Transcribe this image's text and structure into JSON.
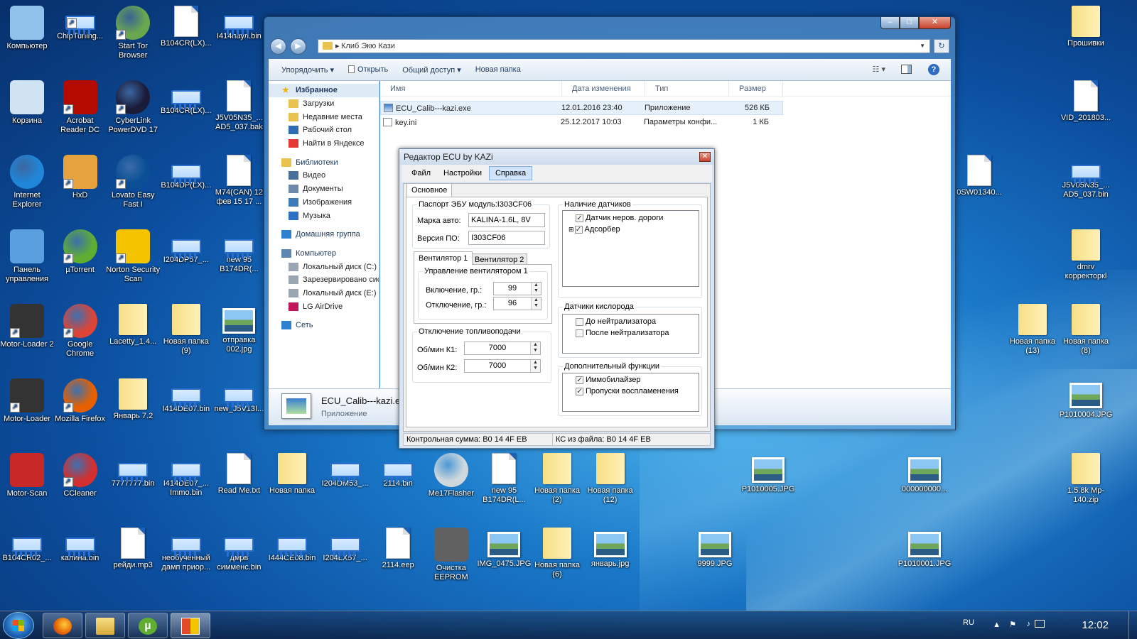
{
  "desktop": {
    "icons": [
      {
        "label": "Компьютер",
        "type": "app",
        "color": "#8fc1ea",
        "shortcut": false,
        "col": 0,
        "row": 0
      },
      {
        "label": "ChipTuning...",
        "type": "chip",
        "shortcut": true,
        "col": 1,
        "row": 0
      },
      {
        "label": "Start Tor Browser",
        "type": "round",
        "color": "#6aa84f",
        "shortcut": true,
        "col": 2,
        "row": 0
      },
      {
        "label": "B104CR(LX)...",
        "type": "doc",
        "shortcut": false,
        "col": 3,
        "row": 0
      },
      {
        "label": "I414паул.bin",
        "type": "chip",
        "shortcut": false,
        "col": 4,
        "row": 0
      },
      {
        "label": "Корзина",
        "type": "app",
        "color": "#cfe3f3",
        "shortcut": false,
        "col": 0,
        "row": 1
      },
      {
        "label": "Acrobat Reader DC",
        "type": "app",
        "color": "#b30b00",
        "shortcut": true,
        "col": 1,
        "row": 1
      },
      {
        "label": "CyberLink PowerDVD 17",
        "type": "round",
        "color": "#1b1b3a",
        "shortcut": true,
        "col": 2,
        "row": 1
      },
      {
        "label": "B104CR(LX)...",
        "type": "chip",
        "shortcut": false,
        "col": 3,
        "row": 1
      },
      {
        "label": "J5V05N35_... AD5_037.bak",
        "type": "doc",
        "shortcut": false,
        "col": 4,
        "row": 1
      },
      {
        "label": "Internet Explorer",
        "type": "round",
        "color": "#1f86d9",
        "shortcut": false,
        "col": 0,
        "row": 2
      },
      {
        "label": "HxD",
        "type": "app",
        "color": "#e6a23c",
        "shortcut": true,
        "col": 1,
        "row": 2
      },
      {
        "label": "Lovato Easy Fast I",
        "type": "round",
        "color": "#0a4f95",
        "shortcut": true,
        "col": 2,
        "row": 2
      },
      {
        "label": "B104DP(LX)...",
        "type": "chip",
        "shortcut": false,
        "col": 3,
        "row": 2
      },
      {
        "label": "M74(CAN) 12 фев 15 17 ...",
        "type": "doc",
        "shortcut": false,
        "col": 4,
        "row": 2
      },
      {
        "label": "Панель управления",
        "type": "app",
        "color": "#5aa0de",
        "shortcut": false,
        "col": 0,
        "row": 3
      },
      {
        "label": "µTorrent",
        "type": "round",
        "color": "#5fae32",
        "shortcut": true,
        "col": 1,
        "row": 3
      },
      {
        "label": "Norton Security Scan",
        "type": "app",
        "color": "#f5c400",
        "shortcut": true,
        "col": 2,
        "row": 3
      },
      {
        "label": "I204DP57_...",
        "type": "chip",
        "shortcut": false,
        "col": 3,
        "row": 3
      },
      {
        "label": "new 95 B174DR(...",
        "type": "chip",
        "shortcut": false,
        "col": 4,
        "row": 3
      },
      {
        "label": "Motor-Loader 2",
        "type": "app",
        "color": "#333333",
        "shortcut": true,
        "col": 0,
        "row": 4
      },
      {
        "label": "Google Chrome",
        "type": "round",
        "color": "#db4437",
        "shortcut": true,
        "col": 1,
        "row": 4
      },
      {
        "label": "Lacetty_1.4...",
        "type": "folder",
        "shortcut": false,
        "col": 2,
        "row": 4
      },
      {
        "label": "Новая папка (9)",
        "type": "folder",
        "shortcut": false,
        "col": 3,
        "row": 4
      },
      {
        "label": "отправка 002.jpg",
        "type": "pic",
        "shortcut": false,
        "col": 4,
        "row": 4
      },
      {
        "label": "Motor-Loader",
        "type": "app",
        "color": "#333333",
        "shortcut": true,
        "col": 0,
        "row": 5
      },
      {
        "label": "Mozilla Firefox",
        "type": "round",
        "color": "#e66000",
        "shortcut": true,
        "col": 1,
        "row": 5
      },
      {
        "label": "Январь 7.2",
        "type": "folder",
        "shortcut": false,
        "col": 2,
        "row": 5
      },
      {
        "label": "I414DE07.bin",
        "type": "chip",
        "shortcut": false,
        "col": 3,
        "row": 5
      },
      {
        "label": "new_J5V13I...",
        "type": "chip",
        "shortcut": false,
        "col": 4,
        "row": 5
      },
      {
        "label": "Motor-Scan",
        "type": "app",
        "color": "#c62828",
        "shortcut": false,
        "col": 0,
        "row": 6
      },
      {
        "label": "CCleaner",
        "type": "round",
        "color": "#d32f2f",
        "shortcut": true,
        "col": 1,
        "row": 6
      },
      {
        "label": "7777777.bin",
        "type": "chip",
        "shortcut": false,
        "col": 2,
        "row": 6
      },
      {
        "label": "I414DE07_... Immo.bin",
        "type": "chip",
        "shortcut": false,
        "col": 3,
        "row": 6
      },
      {
        "label": "Read Me.txt",
        "type": "doc",
        "shortcut": false,
        "col": 4,
        "row": 6
      },
      {
        "label": "Новая папка",
        "type": "folder",
        "shortcut": false,
        "col": 5,
        "row": 6
      },
      {
        "label": "I204DM53_...",
        "type": "chip",
        "shortcut": false,
        "col": 6,
        "row": 6
      },
      {
        "label": "2114.bin",
        "type": "chip",
        "shortcut": false,
        "col": 7,
        "row": 6
      },
      {
        "label": "Me17Flasher",
        "type": "round",
        "color": "#cfd8dc",
        "shortcut": false,
        "col": 8,
        "row": 6
      },
      {
        "label": "new 95 B174DR(L...",
        "type": "doc",
        "shortcut": false,
        "col": 9,
        "row": 6
      },
      {
        "label": "Новая папка (2)",
        "type": "folder",
        "shortcut": false,
        "col": 10,
        "row": 6
      },
      {
        "label": "Новая папка (12)",
        "type": "folder",
        "shortcut": false,
        "col": 11,
        "row": 6
      },
      {
        "label": "B104CR02_...",
        "type": "chip",
        "shortcut": false,
        "col": 0,
        "row": 7
      },
      {
        "label": "калина.bin",
        "type": "chip",
        "shortcut": false,
        "col": 1,
        "row": 7
      },
      {
        "label": "рейди.mp3",
        "type": "doc",
        "shortcut": false,
        "col": 2,
        "row": 7
      },
      {
        "label": "необученный дамп приор...",
        "type": "chip",
        "shortcut": false,
        "col": 3,
        "row": 7
      },
      {
        "label": "дмрв симменс.bin",
        "type": "chip",
        "shortcut": false,
        "col": 4,
        "row": 7
      },
      {
        "label": "I444CE08.bin",
        "type": "chip",
        "shortcut": false,
        "col": 5,
        "row": 7
      },
      {
        "label": "I204LX57_...",
        "type": "chip",
        "shortcut": false,
        "col": 6,
        "row": 7
      },
      {
        "label": "2114.eep",
        "type": "doc",
        "shortcut": false,
        "col": 7,
        "row": 7
      },
      {
        "label": "Очистка EEPROM",
        "type": "app",
        "color": "#616161",
        "shortcut": false,
        "col": 8,
        "row": 7
      },
      {
        "label": "IMG_0475.JPG",
        "type": "pic",
        "shortcut": false,
        "col": 9,
        "row": 7
      },
      {
        "label": "Новая папка (6)",
        "type": "folder",
        "shortcut": false,
        "col": 10,
        "row": 7
      },
      {
        "label": "январь.jpg",
        "type": "pic",
        "shortcut": false,
        "col": 11,
        "row": 7
      },
      {
        "label": "9999.JPG",
        "type": "pic",
        "shortcut": false,
        "col": 13,
        "row": 7
      },
      {
        "label": "P1010001.JPG",
        "type": "pic",
        "shortcut": false,
        "col": 17,
        "row": 7
      },
      {
        "label": "P1010005.JPG",
        "type": "pic",
        "shortcut": false,
        "col": 14,
        "row": 6
      },
      {
        "label": "000000000...",
        "type": "pic",
        "shortcut": false,
        "col": 17,
        "row": 6
      },
      {
        "label": "0SW01340...",
        "type": "doc",
        "shortcut": false,
        "col": 18,
        "row": 2
      },
      {
        "label": "Прошивки",
        "type": "folder",
        "shortcut": false,
        "col": 20,
        "row": 0
      },
      {
        "label": "VID_201803...",
        "type": "doc",
        "shortcut": false,
        "col": 20,
        "row": 1
      },
      {
        "label": "J5V05N35_... AD5_037.bin",
        "type": "chip",
        "shortcut": false,
        "col": 20,
        "row": 2
      },
      {
        "label": "dmrv корректоркl",
        "type": "folder",
        "shortcut": false,
        "col": 20,
        "row": 3
      },
      {
        "label": "Новая папка (13)",
        "type": "folder",
        "shortcut": false,
        "col": 19,
        "row": 4
      },
      {
        "label": "Новая папка (8)",
        "type": "folder",
        "shortcut": false,
        "col": 20,
        "row": 4
      },
      {
        "label": "P1010004.JPG",
        "type": "pic",
        "shortcut": false,
        "col": 20,
        "row": 5
      },
      {
        "label": "1.5.8k Mp-140.zip",
        "type": "folder",
        "shortcut": false,
        "col": 20,
        "row": 6
      }
    ]
  },
  "explorer": {
    "address": "Клиб Экю Кази",
    "toolbar": [
      "Упорядочить ▾",
      "Открыть",
      "Общий доступ ▾",
      "Новая папка"
    ],
    "nav": [
      {
        "label": "Избранное",
        "head": true,
        "sel": true,
        "icon": "star-icon",
        "color": "#f0b300"
      },
      {
        "label": "Загрузки",
        "icon": "folder-icon",
        "color": "#e8c350"
      },
      {
        "label": "Недавние места",
        "icon": "folder-icon",
        "color": "#e8c350"
      },
      {
        "label": "Рабочий стол",
        "icon": "desktop-icon",
        "color": "#2e6db4"
      },
      {
        "label": "Найти в Яндексе",
        "icon": "yandex-icon",
        "color": "#e53935"
      },
      {
        "label": "Библиотеки",
        "head": true,
        "icon": "library-icon",
        "color": "#e8c350"
      },
      {
        "label": "Видео",
        "icon": "video-icon",
        "color": "#4a6f9b"
      },
      {
        "label": "Документы",
        "icon": "documents-icon",
        "color": "#6d88a8"
      },
      {
        "label": "Изображения",
        "icon": "pictures-icon",
        "color": "#3d7ab8"
      },
      {
        "label": "Музыка",
        "icon": "music-icon",
        "color": "#2a73c2"
      },
      {
        "label": "Домашняя группа",
        "head": true,
        "icon": "homegroup-icon",
        "color": "#2f80d0"
      },
      {
        "label": "Компьютер",
        "head": true,
        "icon": "computer-icon",
        "color": "#5c87b2"
      },
      {
        "label": "Локальный диск (C:)",
        "icon": "drive-icon",
        "color": "#9aa7b3"
      },
      {
        "label": "Зарезервировано системой",
        "icon": "drive-icon",
        "color": "#9aa7b3"
      },
      {
        "label": "Локальный диск (E:)",
        "icon": "drive-icon",
        "color": "#9aa7b3"
      },
      {
        "label": "LG AirDrive",
        "icon": "airdrive-icon",
        "color": "#c2185b"
      },
      {
        "label": "Сеть",
        "head": true,
        "icon": "network-icon",
        "color": "#2f80d0"
      }
    ],
    "columns": [
      "Имя",
      "Дата изменения",
      "Тип",
      "Размер"
    ],
    "files": [
      {
        "name": "ECU_Calib---kazi.exe",
        "date": "12.01.2016 23:40",
        "type": "Приложение",
        "size": "526 КБ"
      },
      {
        "name": "key.ini",
        "date": "25.12.2017 10:03",
        "type": "Параметры конфи...",
        "size": "1 КБ"
      }
    ],
    "details": {
      "name": "ECU_Calib---kazi.exe",
      "type": "Приложение"
    }
  },
  "ecu": {
    "title": "Редактор ECU by  KAZi",
    "menu": [
      "Файл",
      "Настройки",
      "Справка"
    ],
    "tab": "Основное",
    "passport": {
      "title": "Паспорт ЭБУ модуль:I303CF06",
      "car_label": "Марка авто:",
      "car_value": "KALINA-1.6L, 8V",
      "ver_label": "Версия ПО:",
      "ver_value": "I303CF06"
    },
    "fan_tabs": [
      "Вентилятор 1",
      "Вентилятор 2"
    ],
    "fan": {
      "title": "Управление вентилятором 1",
      "on_label": "Включение, гр.:",
      "on_value": "99",
      "off_label": "Отключение, гр.:",
      "off_value": "96"
    },
    "fuel": {
      "title": "Отключение топливоподачи",
      "k1_label": "Об/мин К1:",
      "k1_value": "7000",
      "k2_label": "Об/мин К2:",
      "k2_value": "7000"
    },
    "sensors": {
      "title": "Наличие датчиков",
      "items": [
        {
          "label": "Датчик неров. дороги",
          "checked": true
        },
        {
          "label": "Адсорбер",
          "checked": true
        }
      ]
    },
    "oxygen": {
      "title": "Датчики кислорода",
      "items": [
        {
          "label": "До нейтрализатора",
          "checked": false
        },
        {
          "label": "После нейтрализатора",
          "checked": false
        }
      ]
    },
    "extra": {
      "title": "Дополнительный функции",
      "items": [
        {
          "label": "Иммобилайзер",
          "checked": true
        },
        {
          "label": "Пропуски воспламенения",
          "checked": true
        }
      ]
    },
    "status": {
      "checksum": "Контрольная сумма: B0 14 4F EB",
      "file_checksum": "КС из файла: B0 14 4F EB"
    }
  },
  "taskbar": {
    "lang": "RU",
    "time": "12:02"
  }
}
